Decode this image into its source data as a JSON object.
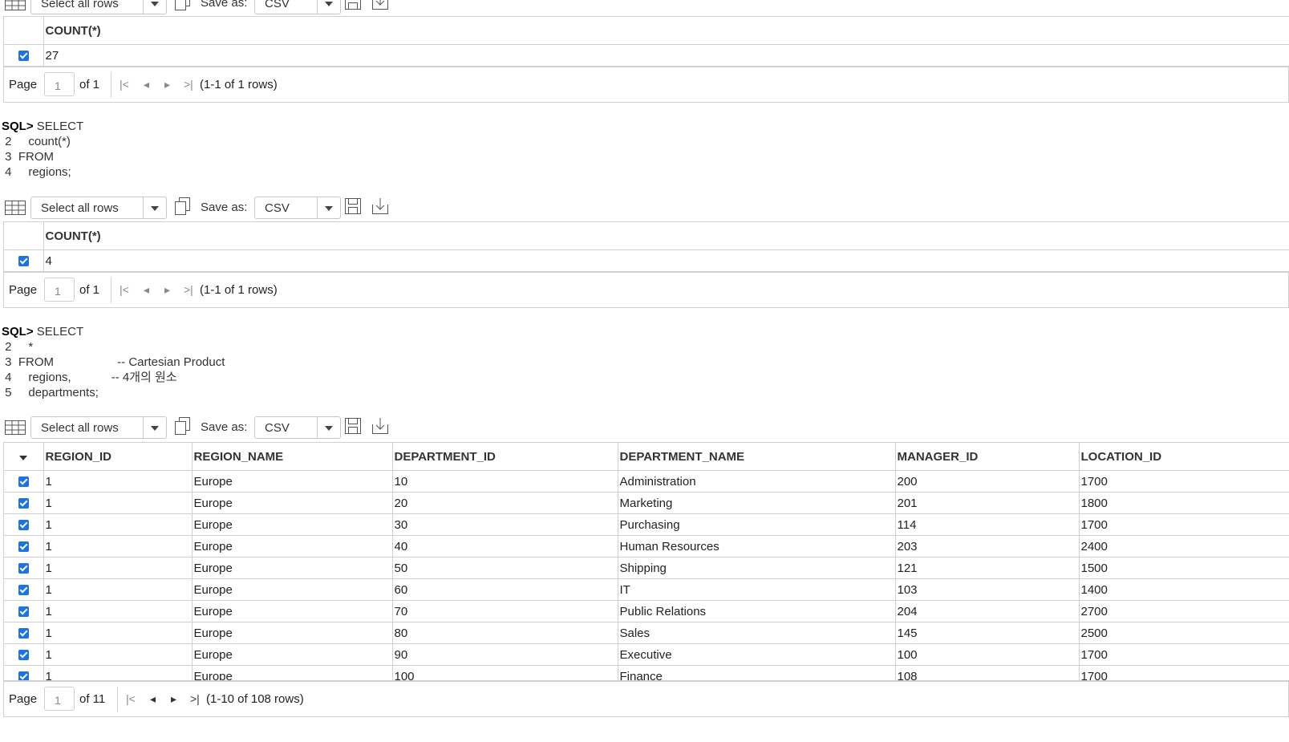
{
  "toolbar": {
    "select_rows": "Select all rows",
    "save_as": "Save as:",
    "format": "CSV"
  },
  "result1": {
    "header": "COUNT(*)",
    "value": "27",
    "pager": {
      "page_label": "Page",
      "page": "1",
      "of": "of 1",
      "rows": "(1-1 of 1 rows)"
    }
  },
  "query2": {
    "prompt": "SQL>",
    "lines": [
      " SELECT",
      " 2     count(*)",
      " 3  FROM",
      " 4     regions;"
    ]
  },
  "result2": {
    "header": "COUNT(*)",
    "value": "4",
    "pager": {
      "page_label": "Page",
      "page": "1",
      "of": "of 1",
      "rows": "(1-1 of 1 rows)"
    }
  },
  "query3": {
    "prompt": "SQL>",
    "lines": [
      " SELECT",
      " 2     *",
      " 3  FROM                   -- Cartesian Product",
      " 4     regions,            -- 4개의 원소",
      " 5     departments;"
    ]
  },
  "result3": {
    "columns": [
      "REGION_ID",
      "REGION_NAME",
      "DEPARTMENT_ID",
      "DEPARTMENT_NAME",
      "MANAGER_ID",
      "LOCATION_ID"
    ],
    "rows": [
      [
        "1",
        "Europe",
        "10",
        "Administration",
        "200",
        "1700"
      ],
      [
        "1",
        "Europe",
        "20",
        "Marketing",
        "201",
        "1800"
      ],
      [
        "1",
        "Europe",
        "30",
        "Purchasing",
        "114",
        "1700"
      ],
      [
        "1",
        "Europe",
        "40",
        "Human Resources",
        "203",
        "2400"
      ],
      [
        "1",
        "Europe",
        "50",
        "Shipping",
        "121",
        "1500"
      ],
      [
        "1",
        "Europe",
        "60",
        "IT",
        "103",
        "1400"
      ],
      [
        "1",
        "Europe",
        "70",
        "Public Relations",
        "204",
        "2700"
      ],
      [
        "1",
        "Europe",
        "80",
        "Sales",
        "145",
        "2500"
      ],
      [
        "1",
        "Europe",
        "90",
        "Executive",
        "100",
        "1700"
      ],
      [
        "1",
        "Europe",
        "100",
        "Finance",
        "108",
        "1700"
      ]
    ],
    "pager": {
      "page_label": "Page",
      "page": "1",
      "of": "of 11",
      "rows": "(1-10 of 108 rows)"
    }
  }
}
